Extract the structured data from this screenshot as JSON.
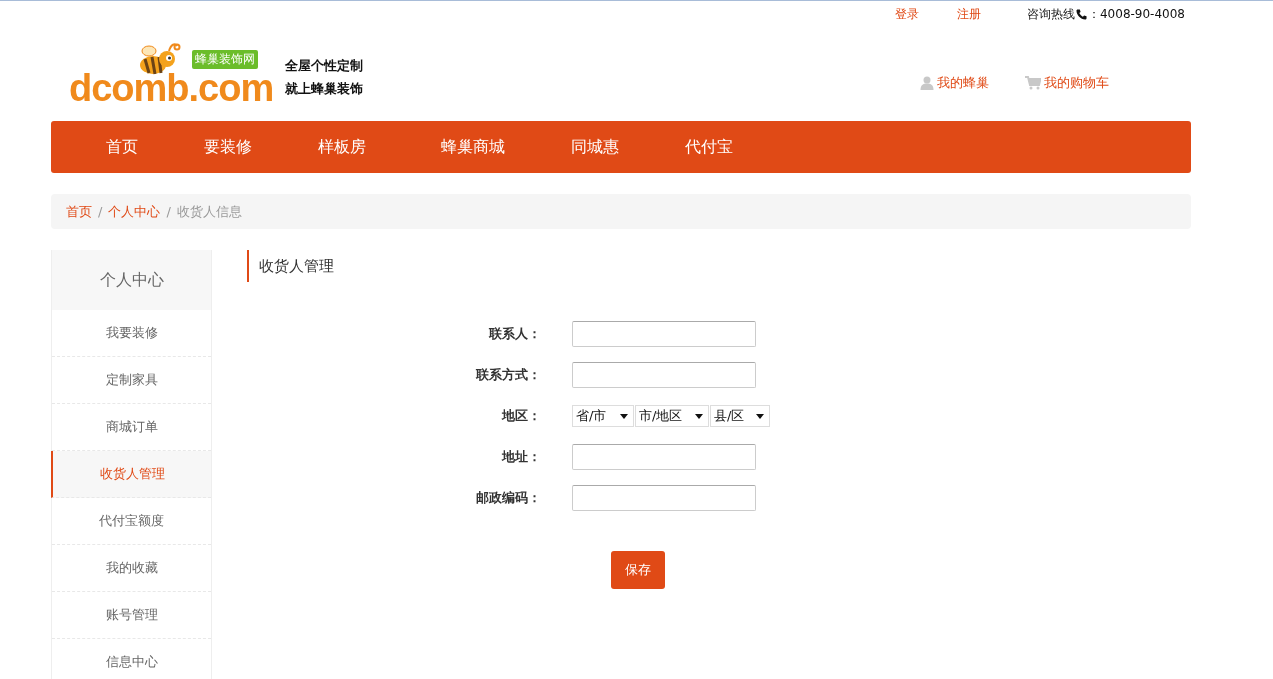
{
  "top_bar": {
    "links": [
      "登录",
      "注册"
    ],
    "hotline_label": "咨询热线",
    "hotline_number": "：4008-90-4008"
  },
  "logo": {
    "wordmark_left": "dcomb",
    "wordmark_right": ".com",
    "badge": "蜂巢装饰网"
  },
  "slogan": [
    "全屋个性定制",
    "就上蜂巢装饰"
  ],
  "user_links": [
    {
      "kind": "user",
      "label": "我的蜂巢"
    },
    {
      "kind": "cart",
      "label": "我的购物车"
    }
  ],
  "nav": [
    "首页",
    "要装修",
    "样板房",
    "蜂巢商城",
    "同城惠",
    "代付宝"
  ],
  "breadcrumb_separator": "/",
  "breadcrumb": [
    {
      "label": "首页",
      "current": false
    },
    {
      "label": "个人中心",
      "current": false
    },
    {
      "label": "收货人信息",
      "current": true
    }
  ],
  "sidebar": {
    "title": "个人中心",
    "items": [
      {
        "label": "我要装修",
        "selected": false
      },
      {
        "label": "定制家具",
        "selected": false
      },
      {
        "label": "商城订单",
        "selected": false
      },
      {
        "label": "收货人管理",
        "selected": true
      },
      {
        "label": "代付宝额度",
        "selected": false
      },
      {
        "label": "我的收藏",
        "selected": false
      },
      {
        "label": "账号管理",
        "selected": false
      },
      {
        "label": "信息中心",
        "selected": false
      }
    ]
  },
  "section_title": "收货人管理",
  "form": {
    "fields": [
      {
        "kind": "text",
        "label": "联系人："
      },
      {
        "kind": "text",
        "label": "联系方式："
      },
      {
        "kind": "selects",
        "label": "地区：",
        "options": [
          "省/市",
          "市/地区",
          "县/区"
        ]
      },
      {
        "kind": "text",
        "label": "地址："
      },
      {
        "kind": "text",
        "label": "邮政编码："
      }
    ],
    "submit": "保存"
  }
}
